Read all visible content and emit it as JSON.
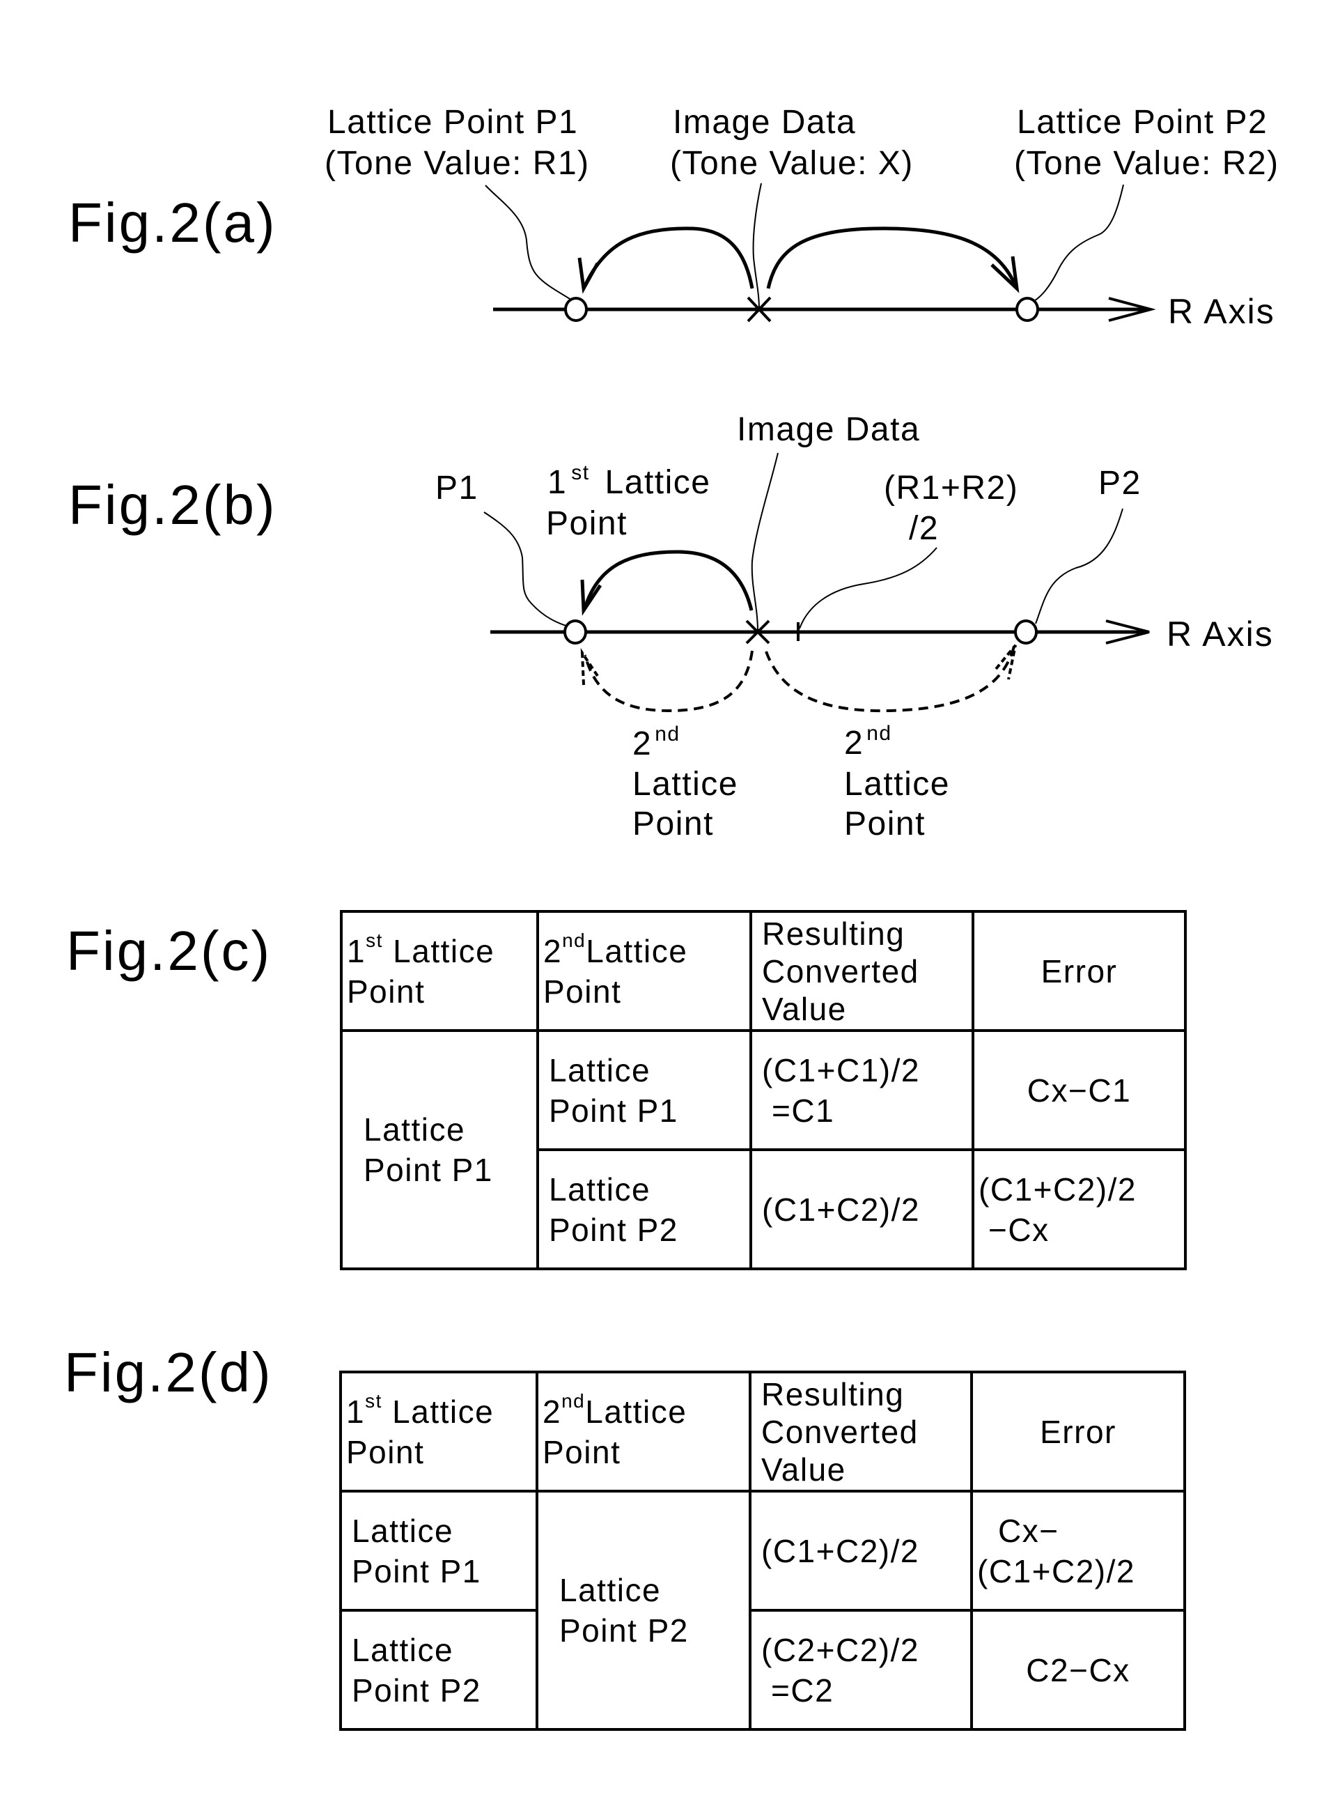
{
  "figures": {
    "a": {
      "label": "Fig.2(a)",
      "lattice_p1": [
        "Lattice Point P1",
        "(Tone Value: R1)"
      ],
      "image_data": [
        "Image Data",
        "(Tone Value: X)"
      ],
      "lattice_p2": [
        "Lattice Point P2",
        "(Tone Value: R2)"
      ],
      "axis_label": "R Axis"
    },
    "b": {
      "label": "Fig.2(b)",
      "p1": "P1",
      "p2": "P2",
      "image_data": "Image Data",
      "first_lattice": {
        "num": "1",
        "sup": "st",
        "rest": "Lattice",
        "line2": "Point"
      },
      "midpoint": [
        "(R1+R2)",
        "/2"
      ],
      "second_lattice_left": {
        "num": "2",
        "sup": "nd",
        "line2": "Lattice",
        "line3": "Point"
      },
      "second_lattice_right": {
        "num": "2",
        "sup": "nd",
        "line2": "Lattice",
        "line3": "Point"
      },
      "axis_label": "R Axis"
    },
    "c": {
      "label": "Fig.2(c)",
      "headers": {
        "first": {
          "num": "1",
          "sup": "st",
          "rest": "Lattice",
          "line2": "Point"
        },
        "second": {
          "num": "2",
          "sup": "nd",
          "rest": "Lattice",
          "line2": "Point"
        },
        "result": [
          "Resulting",
          "Converted",
          "Value"
        ],
        "error": "Error"
      },
      "rows": [
        {
          "first": [
            "Lattice",
            "Point P1"
          ],
          "second": [
            "Lattice",
            "Point P1"
          ],
          "result": [
            "(C1+C1)/2",
            "=C1"
          ],
          "error": [
            "Cx−C1"
          ]
        },
        {
          "second": [
            "Lattice",
            "Point P2"
          ],
          "result": [
            "(C1+C2)/2"
          ],
          "error": [
            "(C1+C2)/2",
            "−Cx"
          ]
        }
      ]
    },
    "d": {
      "label": "Fig.2(d)",
      "headers": {
        "first": {
          "num": "1",
          "sup": "st",
          "rest": "Lattice",
          "line2": "Point"
        },
        "second": {
          "num": "2",
          "sup": "nd",
          "rest": "Lattice",
          "line2": "Point"
        },
        "result": [
          "Resulting",
          "Converted",
          "Value"
        ],
        "error": "Error"
      },
      "rows": [
        {
          "first": [
            "Lattice",
            "Point P1"
          ],
          "second": [
            "Lattice",
            "Point P2"
          ],
          "result": [
            "(C1+C2)/2"
          ],
          "error": [
            "Cx−",
            "(C1+C2)/2"
          ]
        },
        {
          "first": [
            "Lattice",
            "Point P2"
          ],
          "result": [
            "(C2+C2)/2",
            "=C2"
          ],
          "error": [
            "C2−Cx"
          ]
        }
      ]
    }
  }
}
